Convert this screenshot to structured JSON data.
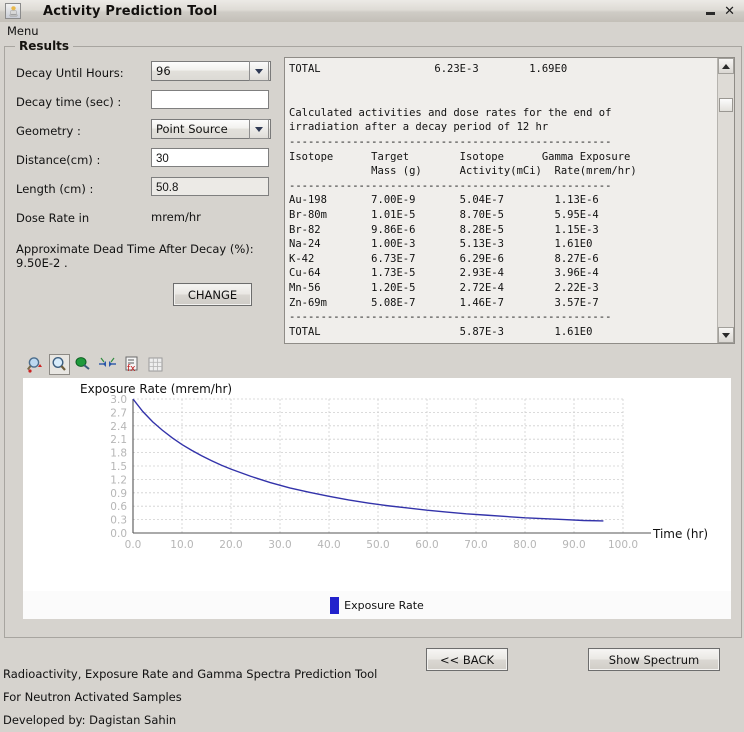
{
  "window": {
    "title": "Activity Prediction Tool",
    "icon": "java-cup-icon",
    "minimize_label": "",
    "close_label": "✕"
  },
  "menubar": {
    "items": [
      {
        "label": "Menu"
      }
    ]
  },
  "results_panel": {
    "legend": "Results"
  },
  "form": {
    "fields": [
      {
        "label": "Decay Until Hours:",
        "type": "combo",
        "value": "96"
      },
      {
        "label": "Decay time (sec) :",
        "type": "text",
        "value": "",
        "placeholder": ""
      },
      {
        "label": "Geometry :",
        "type": "combo",
        "value": "Point Source"
      },
      {
        "label": "Distance(cm) :",
        "type": "text",
        "value": "30",
        "placeholder": ""
      },
      {
        "label": "Length (cm) :",
        "type": "text",
        "value": "50.8",
        "placeholder": ""
      }
    ],
    "dose_rate_label": "Dose Rate in",
    "dose_rate_value": "mrem/hr",
    "dead_time_note": "Approximate Dead Time After Decay (%): 9.50E-2 .",
    "change_button": "CHANGE"
  },
  "results_text": "TOTAL                  6.23E-3        1.69E0\n\n\nCalculated activities and dose rates for the end of\nirradiation after a decay period of 12 hr\n---------------------------------------------------\nIsotope      Target        Isotope      Gamma Exposure\n             Mass (g)      Activity(mCi)  Rate(mrem/hr)\n---------------------------------------------------\nAu-198       7.00E-9       5.04E-7        1.13E-6\nBr-80m       1.01E-5       8.70E-5        5.95E-4\nBr-82        9.86E-6       8.28E-5        1.15E-3\nNa-24        1.00E-3       5.13E-3        1.61E0\nK-42         6.73E-7       6.29E-6        8.27E-6\nCu-64        1.73E-5       2.93E-4        3.96E-4\nMn-56        1.20E-5       2.72E-4        2.22E-3\nZn-69m       5.08E-7       1.46E-7        3.57E-7\n---------------------------------------------------\nTOTAL                      5.87E-3        1.61E0",
  "results_table": {
    "header_total": {
      "label": "TOTAL",
      "activity": "6.23E-3",
      "gamma": "1.69E0"
    },
    "caption": "Calculated activities and dose rates for the end of irradiation after a decay period of 12 hr",
    "columns": [
      "Isotope",
      "Target Mass (g)",
      "Isotope Activity(mCi)",
      "Gamma Exposure Rate(mrem/hr)"
    ],
    "rows": [
      {
        "isotope": "Au-198",
        "mass": "7.00E-9",
        "activity": "5.04E-7",
        "gamma": "1.13E-6"
      },
      {
        "isotope": "Br-80m",
        "mass": "1.01E-5",
        "activity": "8.70E-5",
        "gamma": "5.95E-4"
      },
      {
        "isotope": "Br-82",
        "mass": "9.86E-6",
        "activity": "8.28E-5",
        "gamma": "1.15E-3"
      },
      {
        "isotope": "Na-24",
        "mass": "1.00E-3",
        "activity": "5.13E-3",
        "gamma": "1.61E0"
      },
      {
        "isotope": "K-42",
        "mass": "6.73E-7",
        "activity": "6.29E-6",
        "gamma": "8.27E-6"
      },
      {
        "isotope": "Cu-64",
        "mass": "1.73E-5",
        "activity": "2.93E-4",
        "gamma": "3.96E-4"
      },
      {
        "isotope": "Mn-56",
        "mass": "1.20E-5",
        "activity": "2.72E-4",
        "gamma": "2.22E-3"
      },
      {
        "isotope": "Zn-69m",
        "mass": "5.08E-7",
        "activity": "1.46E-7",
        "gamma": "3.57E-7"
      }
    ],
    "footer_total": {
      "label": "TOTAL",
      "activity": "5.87E-3",
      "gamma": "1.61E0"
    }
  },
  "chart_toolbar": {
    "buttons": [
      {
        "name": "zoom-in-icon",
        "selected": false
      },
      {
        "name": "zoom-box-icon",
        "selected": true
      },
      {
        "name": "pan-hand-icon",
        "selected": false
      },
      {
        "name": "fit-width-icon",
        "selected": false
      },
      {
        "name": "clear-axis-icon",
        "selected": false
      },
      {
        "name": "grid-table-icon",
        "selected": false
      }
    ]
  },
  "chart_data": {
    "type": "line",
    "title": "",
    "ylabel": "Exposure Rate (mrem/hr)",
    "xlabel": "Time (hr)",
    "xlim": [
      0.0,
      100.0
    ],
    "ylim": [
      0.0,
      3.0
    ],
    "xticks": [
      "0.0",
      "10.0",
      "20.0",
      "30.0",
      "40.0",
      "50.0",
      "60.0",
      "70.0",
      "80.0",
      "90.0",
      "100.0"
    ],
    "yticks": [
      "0.0",
      "0.3",
      "0.6",
      "0.9",
      "1.2",
      "1.5",
      "1.8",
      "2.1",
      "2.4",
      "2.7",
      "3.0"
    ],
    "grid": true,
    "legend_position": "bottom",
    "series": [
      {
        "name": "Exposure Rate",
        "color": "#3333aa",
        "x": [
          0,
          2,
          4,
          6,
          8,
          10,
          12,
          14,
          16,
          18,
          20,
          24,
          28,
          32,
          36,
          40,
          44,
          48,
          52,
          56,
          60,
          64,
          68,
          72,
          76,
          80,
          84,
          88,
          92,
          96
        ],
        "y": [
          3.0,
          2.72,
          2.49,
          2.3,
          2.13,
          1.98,
          1.85,
          1.73,
          1.62,
          1.52,
          1.43,
          1.27,
          1.13,
          1.01,
          0.91,
          0.82,
          0.74,
          0.67,
          0.61,
          0.56,
          0.51,
          0.47,
          0.43,
          0.4,
          0.37,
          0.34,
          0.32,
          0.3,
          0.28,
          0.27
        ]
      }
    ]
  },
  "chart_legend": {
    "label": "Exposure Rate",
    "color": "#2222cc"
  },
  "actions": {
    "back": "<< BACK",
    "show_spectrum": "Show Spectrum"
  },
  "footer": {
    "line1": "Radioactivity, Exposure Rate and Gamma Spectra Prediction Tool",
    "line2": "For Neutron Activated Samples",
    "line3": "Developed by: Dagistan Sahin"
  }
}
